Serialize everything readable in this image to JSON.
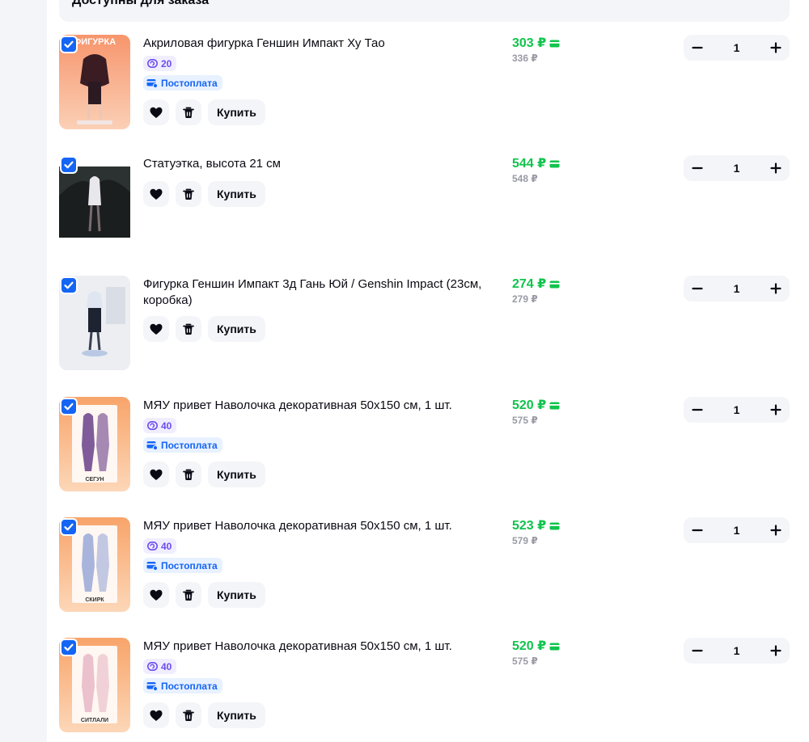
{
  "section": {
    "title": "Доступны для заказа"
  },
  "labels": {
    "buy": "Купить",
    "postpay": "Постоплата"
  },
  "colors": {
    "accent": "#1565f5",
    "price": "#10c44c",
    "points": "#6d4cf0"
  },
  "items": [
    {
      "title": "Акриловая фигурка Геншин Импакт Ху Тао",
      "points": "20",
      "postpay": true,
      "price": "303 ₽",
      "old_price": "336 ₽",
      "qty": "1",
      "checked": true,
      "image_text": "ФИГУРКА"
    },
    {
      "title": "Статуэтка, высота 21 см",
      "points": null,
      "postpay": false,
      "price": "544 ₽",
      "old_price": "548 ₽",
      "qty": "1",
      "checked": true
    },
    {
      "title": "Фигурка Геншин Импакт 3д Гань Юй / Genshin Impact (23см, коробка)",
      "points": null,
      "postpay": false,
      "price": "274 ₽",
      "old_price": "279 ₽",
      "qty": "1",
      "checked": true
    },
    {
      "title": "МЯУ привет Наволочка декоративная 50х150 см, 1 шт.",
      "points": "40",
      "postpay": true,
      "price": "520 ₽",
      "old_price": "575 ₽",
      "qty": "1",
      "checked": true,
      "image_text": "СЕГУН"
    },
    {
      "title": "МЯУ привет Наволочка декоративная 50х150 см, 1 шт.",
      "points": "40",
      "postpay": true,
      "price": "523 ₽",
      "old_price": "579 ₽",
      "qty": "1",
      "checked": true,
      "image_text": "СКИРК"
    },
    {
      "title": "МЯУ привет Наволочка декоративная 50х150 см, 1 шт.",
      "points": "40",
      "postpay": true,
      "price": "520 ₽",
      "old_price": "575 ₽",
      "qty": "1",
      "checked": true,
      "image_text": "СИТЛАЛИ"
    }
  ]
}
